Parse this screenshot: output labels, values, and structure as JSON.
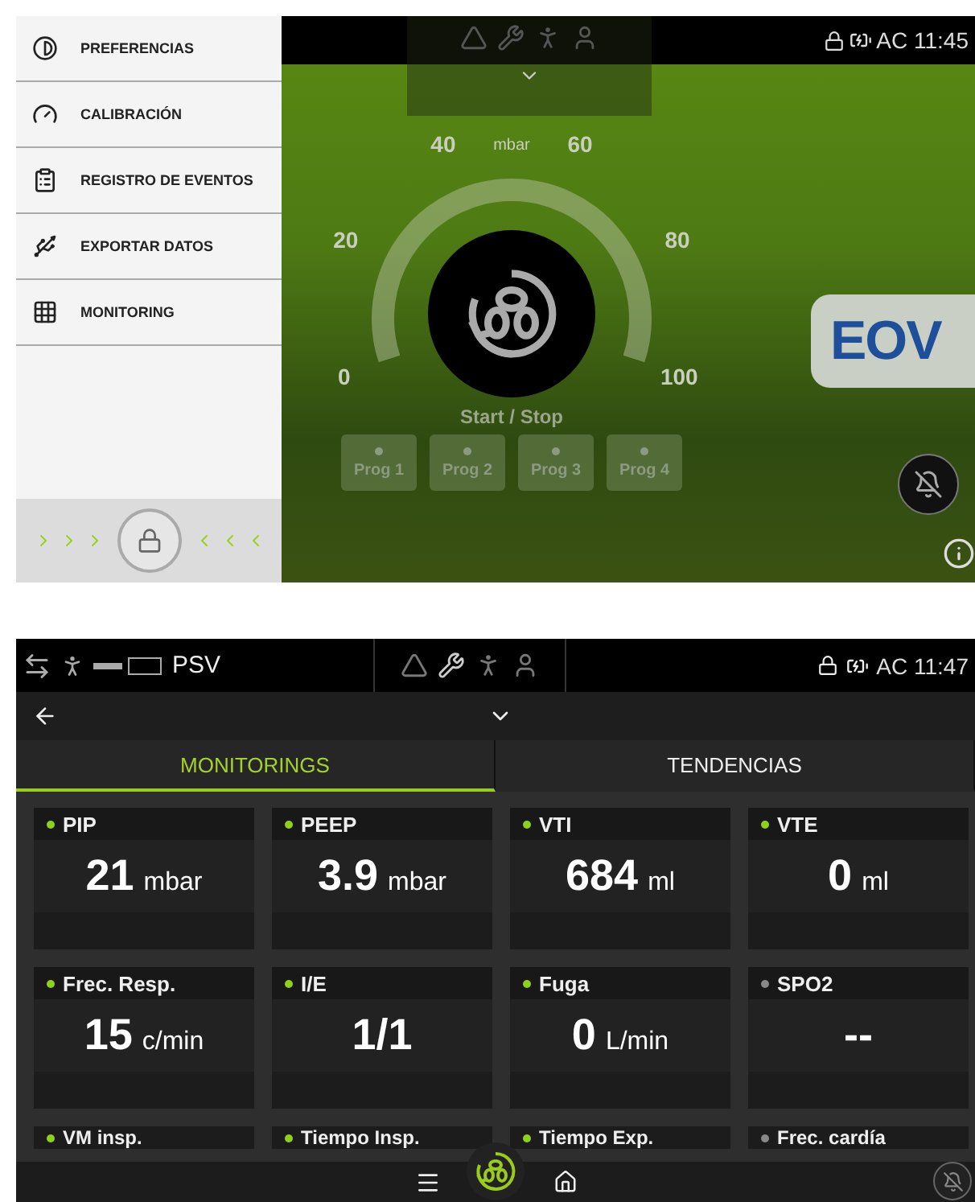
{
  "top_screen": {
    "menu": [
      {
        "label": "PREFERENCIAS",
        "kind": "contrast"
      },
      {
        "label": "CALIBRACIÓN",
        "kind": "gauge"
      },
      {
        "label": "REGISTRO DE EVENTOS",
        "kind": "clipboard"
      },
      {
        "label": "EXPORTAR DATOS",
        "kind": "usb"
      },
      {
        "label": "MONITORING",
        "kind": "grid"
      }
    ],
    "status_time": "AC 11:45",
    "gauge": {
      "unit": "mbar",
      "scale": [
        "0",
        "20",
        "40",
        "60",
        "80",
        "100"
      ]
    },
    "start_label": "Start / Stop",
    "programs": [
      "Prog 1",
      "Prog 2",
      "Prog 3",
      "Prog 4"
    ],
    "logo": "EOV",
    "unlock_slider": {
      "locked": true
    }
  },
  "bottom_screen": {
    "mode": "PSV",
    "status_time": "AC 11:47",
    "tabs": [
      {
        "label": "MONITORINGS",
        "selected": true
      },
      {
        "label": "TENDENCIAS",
        "selected": false
      }
    ],
    "cards": [
      {
        "label": "PIP",
        "value": "21",
        "unit": "mbar",
        "active": true
      },
      {
        "label": "PEEP",
        "value": "3.9",
        "unit": "mbar",
        "active": true
      },
      {
        "label": "VTI",
        "value": "684",
        "unit": "ml",
        "active": true
      },
      {
        "label": "VTE",
        "value": "0",
        "unit": "ml",
        "active": true
      },
      {
        "label": "Frec. Resp.",
        "value": "15",
        "unit": "c/min",
        "active": true
      },
      {
        "label": "I/E",
        "value": "1/1",
        "active": true
      },
      {
        "label": "Fuga",
        "value": "0",
        "unit": "L/min",
        "active": true
      },
      {
        "label": "SPO2",
        "value": "--",
        "active": false
      }
    ],
    "cut_cards": [
      {
        "label": "VM insp.",
        "active": true
      },
      {
        "label": "Tiempo Insp.",
        "active": true
      },
      {
        "label": "Tiempo Exp.",
        "active": true
      },
      {
        "label": "Frec. cardía",
        "active": false
      }
    ]
  }
}
